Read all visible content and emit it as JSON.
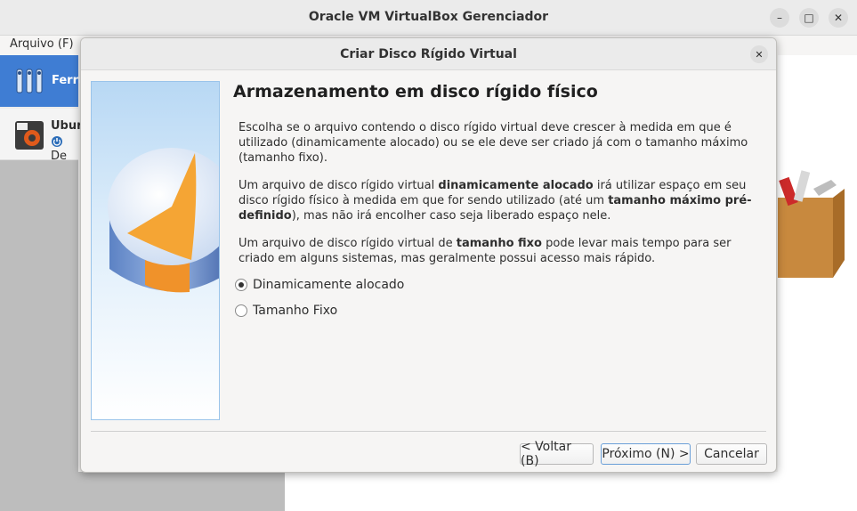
{
  "window": {
    "title": "Oracle VM VirtualBox Gerenciador",
    "minimize_label": "–",
    "maximize_label": "□",
    "close_label": "✕"
  },
  "menubar": {
    "file_label": "Arquivo (F)"
  },
  "sidebar": {
    "tools_label": "Ferra",
    "vm_name": "Ubur",
    "vm_state": "De"
  },
  "dialog": {
    "title": "Criar Disco Rígido Virtual",
    "close_label": "✕",
    "heading": "Armazenamento em disco rígido físico",
    "para1": "Escolha se o arquivo contendo o disco rígido virtual deve crescer à medida em que é utilizado (dinamicamente alocado) ou se ele deve ser criado já com o tamanho máximo (tamanho fixo).",
    "para2": {
      "part1": "Um arquivo de disco rígido virtual ",
      "bold1": "dinamicamente alocado",
      "part2": " irá utilizar espaço em seu disco rígido físico à medida em que for sendo utilizado (até um ",
      "bold2": "tamanho máximo pré-definido",
      "part3": "), mas não irá encolher caso seja liberado espaço nele."
    },
    "para3": {
      "part1": "Um arquivo de disco rígido virtual de ",
      "bold1": "tamanho fixo",
      "part2": " pode levar mais tempo para ser criado em alguns sistemas, mas geralmente possui acesso mais rápido."
    },
    "options": [
      {
        "label": "Dinamicamente alocado",
        "checked": true
      },
      {
        "label": "Tamanho Fixo",
        "checked": false
      }
    ],
    "buttons": {
      "back": "< Voltar (B)",
      "next": "Próximo (N) >",
      "cancel": "Cancelar"
    }
  }
}
